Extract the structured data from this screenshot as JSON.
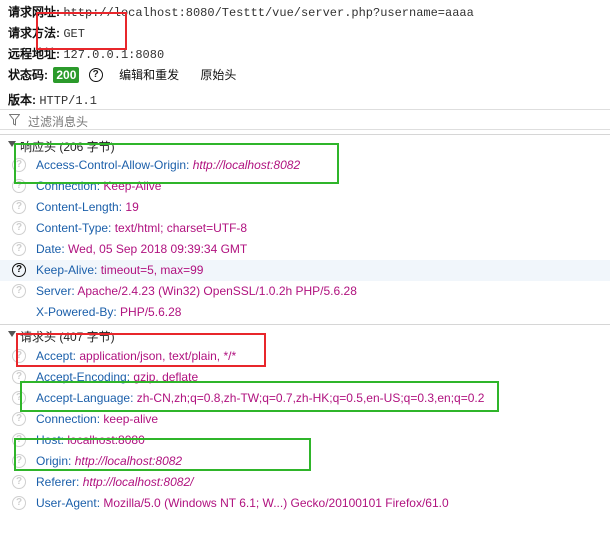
{
  "summary": {
    "url_label": "请求网址:",
    "url_value": "http://localhost:8080/Testtt/vue/server.php?username=aaaa",
    "method_label": "请求方法:",
    "method_value": "GET",
    "remote_label": "远程地址:",
    "remote_value": "127.0.0.1:8080",
    "status_label": "状态码:",
    "status_value": "200",
    "edit_resend": "编辑和重发",
    "raw_headers": "原始头",
    "version_label": "版本:",
    "version_value": "HTTP/1.1"
  },
  "filter": {
    "placeholder": "过滤消息头"
  },
  "response_section": {
    "label": "响应头 (206 字节)",
    "headers": [
      {
        "name": "Access-Control-Allow-Origin:",
        "value": "http://localhost:8082"
      },
      {
        "name": "Connection:",
        "value": "Keep-Alive"
      },
      {
        "name": "Content-Length:",
        "value": "19"
      },
      {
        "name": "Content-Type:",
        "value": "text/html; charset=UTF-8"
      },
      {
        "name": "Date:",
        "value": "Wed, 05 Sep 2018 09:39:34 GMT"
      },
      {
        "name": "Keep-Alive:",
        "value": "timeout=5, max=99"
      },
      {
        "name": "Server:",
        "value": "Apache/2.4.23 (Win32) OpenSSL/1.0.2h PHP/5.6.28"
      },
      {
        "name": "X-Powered-By:",
        "value": "PHP/5.6.28"
      }
    ]
  },
  "request_section": {
    "label": "请求头 (407 字节)",
    "headers": [
      {
        "name": "Accept:",
        "value": "application/json, text/plain, */*"
      },
      {
        "name": "Accept-Encoding:",
        "value": "gzip, deflate"
      },
      {
        "name": "Accept-Language:",
        "value": "zh-CN,zh;q=0.8,zh-TW;q=0.7,zh-HK;q=0.5,en-US;q=0.3,en;q=0.2"
      },
      {
        "name": "Connection:",
        "value": "keep-alive"
      },
      {
        "name": "Host:",
        "value": "localhost:8080"
      },
      {
        "name": "Origin:",
        "value": "http://localhost:8082"
      },
      {
        "name": "Referer:",
        "value": "http://localhost:8082/"
      },
      {
        "name": "User-Agent:",
        "value": "Mozilla/5.0 (Windows NT 6.1; W...) Gecko/20100101 Firefox/61.0"
      }
    ]
  },
  "icons": {
    "help": "question-circle-icon",
    "filter": "filter-icon",
    "collapse": "triangle-down-icon"
  },
  "colors": {
    "header_name": "#1b5faa",
    "header_value": "#b0127f",
    "status_badge": "#2b9a2b",
    "annotation_red": "#e8262b",
    "annotation_green": "#2fb52a"
  }
}
